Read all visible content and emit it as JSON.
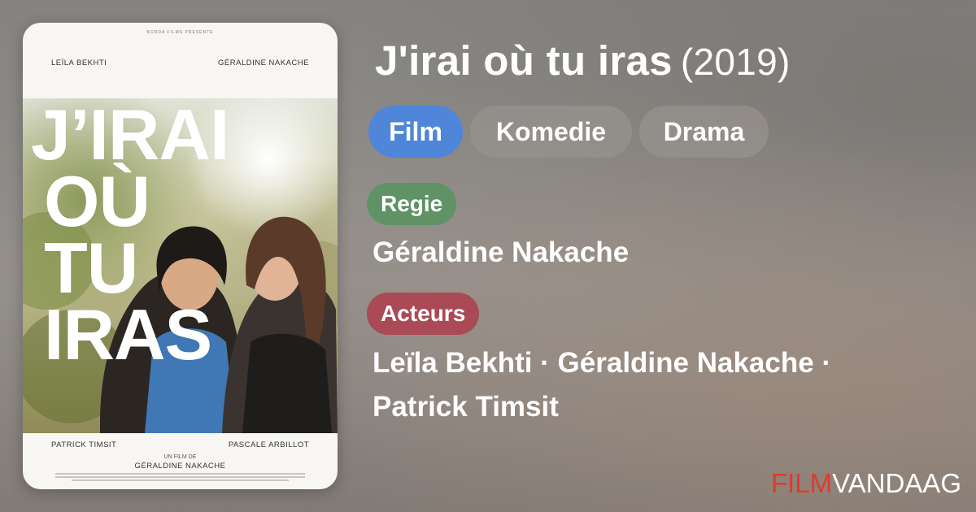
{
  "poster": {
    "studio_text": "KORDA FILMS PRESENTE",
    "actor_top_left": "LEÏLA BEKHTI",
    "actor_top_right": "GÉRALDINE NAKACHE",
    "title_lines": [
      "J’IRAI",
      "OÙ",
      "TU",
      "IRAS"
    ],
    "actor_bottom_left": "PATRICK TIMSIT",
    "actor_bottom_right": "PASCALE ARBILLOT",
    "director_prefix": "UN FILM DE",
    "director_name": "GÉRALDINE NAKACHE"
  },
  "movie": {
    "title": "J'irai où tu iras",
    "year": "(2019)"
  },
  "genres": [
    {
      "label": "Film",
      "color": "#4f86d9"
    },
    {
      "label": "Komedie",
      "color": "#96928e"
    },
    {
      "label": "Drama",
      "color": "#96928e"
    }
  ],
  "regie": {
    "label": "Regie",
    "color": "#5f9365",
    "value": "Géraldine Nakache"
  },
  "acteurs": {
    "label": "Acteurs",
    "color": "#a94a56",
    "value": "Leïla Bekhti · Géraldine Nakache · Patrick Timsit"
  },
  "brand": {
    "part1": "FILM",
    "part2": "VANDAAG",
    "color1": "#e03b2c",
    "color2": "#ffffff"
  }
}
